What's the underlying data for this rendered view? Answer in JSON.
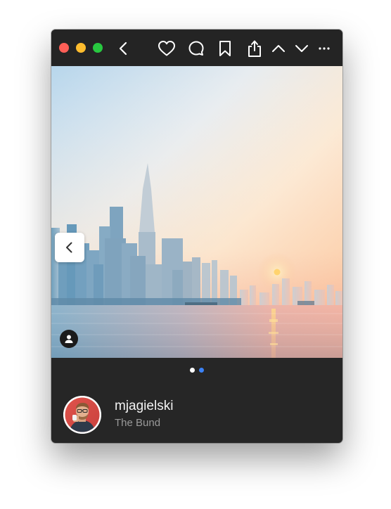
{
  "window": {
    "traffic_lights": [
      {
        "name": "close",
        "color": "#fe5f57"
      },
      {
        "name": "minimize",
        "color": "#febc2e"
      },
      {
        "name": "zoom",
        "color": "#28c840"
      }
    ]
  },
  "toolbar": {
    "icons": [
      "chevron-left-icon",
      "heart-icon",
      "comment-icon",
      "bookmark-icon",
      "share-icon",
      "chevron-up-icon",
      "chevron-down-icon",
      "more-icon"
    ]
  },
  "photo": {
    "description_icon": "user-tag-icon",
    "carousel": {
      "count": 2,
      "active_index": 1,
      "active_color": "#3b82f6",
      "inactive_color": "#ffffff"
    }
  },
  "post": {
    "username": "mjagielski",
    "location": "The Bund"
  },
  "colors": {
    "window_bg": "#262626",
    "titlebar_bg": "#242424",
    "icon_color": "#ffffff"
  }
}
